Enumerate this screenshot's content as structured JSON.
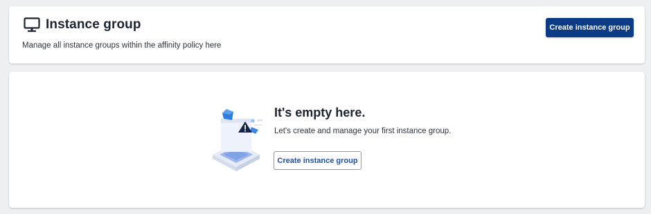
{
  "header": {
    "icon": "monitor-icon",
    "title": "Instance group",
    "subtitle": "Manage all instance groups within the affinity policy here",
    "create_button_label": "Create instance group"
  },
  "empty_state": {
    "illustration": "empty-box-warning-illustration",
    "title": "It's empty here.",
    "description": "Let's create and manage your first instance group.",
    "create_button_label": "Create instance group"
  },
  "colors": {
    "primary": "#0b3a87",
    "outline_text": "#1d4f9e",
    "background": "#eef0f3",
    "card": "#ffffff"
  }
}
